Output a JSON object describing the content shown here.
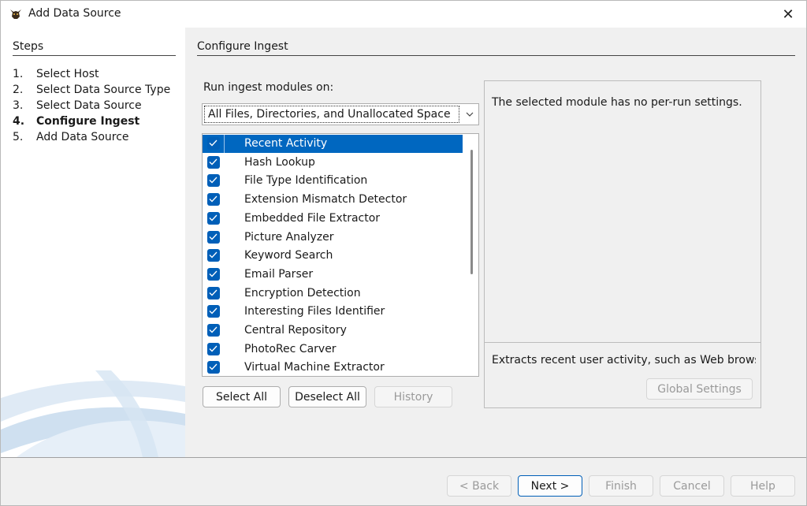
{
  "window": {
    "title": "Add Data Source",
    "app_icon": "autopsy-dog-icon",
    "close_glyph": "✕"
  },
  "steps": {
    "title": "Steps",
    "items": [
      {
        "num": "1.",
        "label": "Select Host"
      },
      {
        "num": "2.",
        "label": "Select Data Source Type"
      },
      {
        "num": "3.",
        "label": "Select Data Source"
      },
      {
        "num": "4.",
        "label": "Configure Ingest"
      },
      {
        "num": "5.",
        "label": "Add Data Source"
      }
    ],
    "active_index": 3
  },
  "main": {
    "title": "Configure Ingest",
    "run_label": "Run ingest modules on:",
    "run_value": "All Files, Directories, and Unallocated Space",
    "modules": [
      {
        "label": "Recent Activity",
        "checked": true,
        "selected": true
      },
      {
        "label": "Hash Lookup",
        "checked": true,
        "selected": false
      },
      {
        "label": "File Type Identification",
        "checked": true,
        "selected": false
      },
      {
        "label": "Extension Mismatch Detector",
        "checked": true,
        "selected": false
      },
      {
        "label": "Embedded File Extractor",
        "checked": true,
        "selected": false
      },
      {
        "label": "Picture Analyzer",
        "checked": true,
        "selected": false
      },
      {
        "label": "Keyword Search",
        "checked": true,
        "selected": false
      },
      {
        "label": "Email Parser",
        "checked": true,
        "selected": false
      },
      {
        "label": "Encryption Detection",
        "checked": true,
        "selected": false
      },
      {
        "label": "Interesting Files Identifier",
        "checked": true,
        "selected": false
      },
      {
        "label": "Central Repository",
        "checked": true,
        "selected": false
      },
      {
        "label": "PhotoRec Carver",
        "checked": true,
        "selected": false
      },
      {
        "label": "Virtual Machine Extractor",
        "checked": true,
        "selected": false
      }
    ],
    "buttons": {
      "select_all": "Select All",
      "deselect_all": "Deselect All",
      "history": "History"
    }
  },
  "settings": {
    "per_run_text": "The selected module has no per-run settings.",
    "description": "Extracts recent user activity, such as Web browsin...",
    "global_settings": "Global Settings"
  },
  "footer": {
    "back": "< Back",
    "next": "Next >",
    "finish": "Finish",
    "cancel": "Cancel",
    "help": "Help"
  },
  "colors": {
    "selection": "#0067c0",
    "checkbox": "#005fb8",
    "panel_bg": "#f0f0f0"
  }
}
